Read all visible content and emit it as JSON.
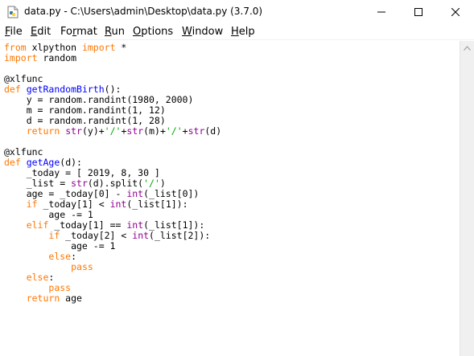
{
  "window": {
    "title": "data.py - C:\\Users\\admin\\Desktop\\data.py (3.7.0)",
    "icon": "python-file-icon"
  },
  "menu": [
    {
      "first": "F",
      "rest": "ile"
    },
    {
      "first": "E",
      "rest": "dit"
    },
    {
      "first": "Fo",
      "ul": "r",
      "rest": "mat"
    },
    {
      "first": "R",
      "rest": "un"
    },
    {
      "first": "O",
      "rest": "ptions"
    },
    {
      "first": "W",
      "rest": "indow"
    },
    {
      "first": "H",
      "rest": "elp"
    }
  ],
  "colors": {
    "keyword": "#ff7700",
    "builtin": "#900090",
    "definition": "#0000ff",
    "string": "#00aa00"
  },
  "code": [
    [
      [
        "kw",
        "from"
      ],
      [
        "p",
        " xlpython "
      ],
      [
        "kw",
        "import"
      ],
      [
        "p",
        " *"
      ]
    ],
    [
      [
        "kw",
        "import"
      ],
      [
        "p",
        " random"
      ]
    ],
    [],
    [
      [
        "p",
        "@xlfunc"
      ]
    ],
    [
      [
        "kw",
        "def"
      ],
      [
        "p",
        " "
      ],
      [
        "def",
        "getRandomBirth"
      ],
      [
        "p",
        "():"
      ]
    ],
    [
      [
        "p",
        "    y = random.randint(1980, 2000)"
      ]
    ],
    [
      [
        "p",
        "    m = random.randint(1, 12)"
      ]
    ],
    [
      [
        "p",
        "    d = random.randint(1, 28)"
      ]
    ],
    [
      [
        "p",
        "    "
      ],
      [
        "kw",
        "return"
      ],
      [
        "p",
        " "
      ],
      [
        "bi",
        "str"
      ],
      [
        "p",
        "(y)+"
      ],
      [
        "str",
        "'/'"
      ],
      [
        "p",
        "+"
      ],
      [
        "bi",
        "str"
      ],
      [
        "p",
        "(m)+"
      ],
      [
        "str",
        "'/'"
      ],
      [
        "p",
        "+"
      ],
      [
        "bi",
        "str"
      ],
      [
        "p",
        "(d)"
      ]
    ],
    [],
    [
      [
        "p",
        "@xlfunc"
      ]
    ],
    [
      [
        "kw",
        "def"
      ],
      [
        "p",
        " "
      ],
      [
        "def",
        "getAge"
      ],
      [
        "p",
        "(d):"
      ]
    ],
    [
      [
        "p",
        "    _today = [ 2019, 8, 30 ]"
      ]
    ],
    [
      [
        "p",
        "    _list = "
      ],
      [
        "bi",
        "str"
      ],
      [
        "p",
        "(d).split("
      ],
      [
        "str",
        "'/'"
      ],
      [
        "p",
        ")"
      ]
    ],
    [
      [
        "p",
        "    age = _today[0] - "
      ],
      [
        "bi",
        "int"
      ],
      [
        "p",
        "(_list[0])"
      ]
    ],
    [
      [
        "p",
        "    "
      ],
      [
        "kw",
        "if"
      ],
      [
        "p",
        " _today[1] < "
      ],
      [
        "bi",
        "int"
      ],
      [
        "p",
        "(_list[1]):"
      ]
    ],
    [
      [
        "p",
        "        age -= 1"
      ]
    ],
    [
      [
        "p",
        "    "
      ],
      [
        "kw",
        "elif"
      ],
      [
        "p",
        " _today[1] == "
      ],
      [
        "bi",
        "int"
      ],
      [
        "p",
        "(_list[1]):"
      ]
    ],
    [
      [
        "p",
        "        "
      ],
      [
        "kw",
        "if"
      ],
      [
        "p",
        " _today[2] < "
      ],
      [
        "bi",
        "int"
      ],
      [
        "p",
        "(_list[2]):"
      ]
    ],
    [
      [
        "p",
        "            age -= 1"
      ]
    ],
    [
      [
        "p",
        "        "
      ],
      [
        "kw",
        "else"
      ],
      [
        "p",
        ":"
      ]
    ],
    [
      [
        "p",
        "            "
      ],
      [
        "kw",
        "pass"
      ]
    ],
    [
      [
        "p",
        "    "
      ],
      [
        "kw",
        "else"
      ],
      [
        "p",
        ":"
      ]
    ],
    [
      [
        "p",
        "        "
      ],
      [
        "kw",
        "pass"
      ]
    ],
    [
      [
        "p",
        "    "
      ],
      [
        "kw",
        "return"
      ],
      [
        "p",
        " age"
      ]
    ]
  ]
}
